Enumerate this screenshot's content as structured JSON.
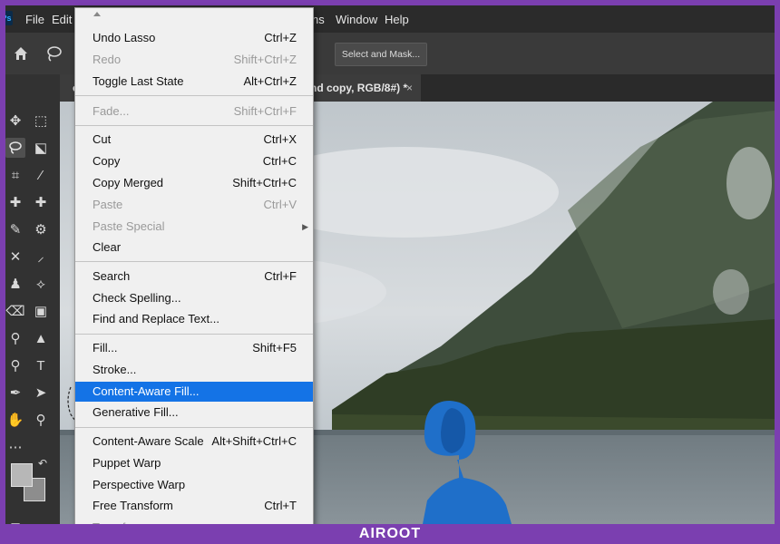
{
  "menubar": {
    "logo": "Ps",
    "items": [
      "File",
      "Edit",
      "ns",
      "Window",
      "Help"
    ]
  },
  "options": {
    "select_and_mask": "Select and Mask..."
  },
  "tab": {
    "left_fragment": "c",
    "title_fragment": "nd copy, RGB/8#) *",
    "close": "×"
  },
  "edit_menu": {
    "items": [
      {
        "label": "Undo Lasso",
        "shortcut": "Ctrl+Z",
        "disabled": false
      },
      {
        "label": "Redo",
        "shortcut": "Shift+Ctrl+Z",
        "disabled": true
      },
      {
        "label": "Toggle Last State",
        "shortcut": "Alt+Ctrl+Z",
        "disabled": false
      },
      {
        "label": "Fade...",
        "shortcut": "Shift+Ctrl+F",
        "disabled": true
      },
      {
        "label": "Cut",
        "shortcut": "Ctrl+X",
        "disabled": false
      },
      {
        "label": "Copy",
        "shortcut": "Ctrl+C",
        "disabled": false
      },
      {
        "label": "Copy Merged",
        "shortcut": "Shift+Ctrl+C",
        "disabled": false
      },
      {
        "label": "Paste",
        "shortcut": "Ctrl+V",
        "disabled": true
      },
      {
        "label": "Paste Special",
        "shortcut": "",
        "disabled": true
      },
      {
        "label": "Clear",
        "shortcut": "",
        "disabled": false
      },
      {
        "label": "Search",
        "shortcut": "Ctrl+F",
        "disabled": false
      },
      {
        "label": "Check Spelling...",
        "shortcut": "",
        "disabled": false
      },
      {
        "label": "Find and Replace Text...",
        "shortcut": "",
        "disabled": false
      },
      {
        "label": "Fill...",
        "shortcut": "Shift+F5",
        "disabled": false
      },
      {
        "label": "Stroke...",
        "shortcut": "",
        "disabled": false
      },
      {
        "label": "Content-Aware Fill...",
        "shortcut": "",
        "disabled": false
      },
      {
        "label": "Generative Fill...",
        "shortcut": "",
        "disabled": false
      },
      {
        "label": "Content-Aware Scale",
        "shortcut": "Alt+Shift+Ctrl+C",
        "disabled": false
      },
      {
        "label": "Puppet Warp",
        "shortcut": "",
        "disabled": false
      },
      {
        "label": "Perspective Warp",
        "shortcut": "",
        "disabled": false
      },
      {
        "label": "Free Transform",
        "shortcut": "Ctrl+T",
        "disabled": false
      },
      {
        "label": "Transform",
        "shortcut": "",
        "disabled": true
      }
    ]
  },
  "watermark": "AIROOT",
  "colors": {
    "accent": "#1473e6",
    "frame": "#7b3fb0",
    "hood": "#1f6fc9"
  }
}
